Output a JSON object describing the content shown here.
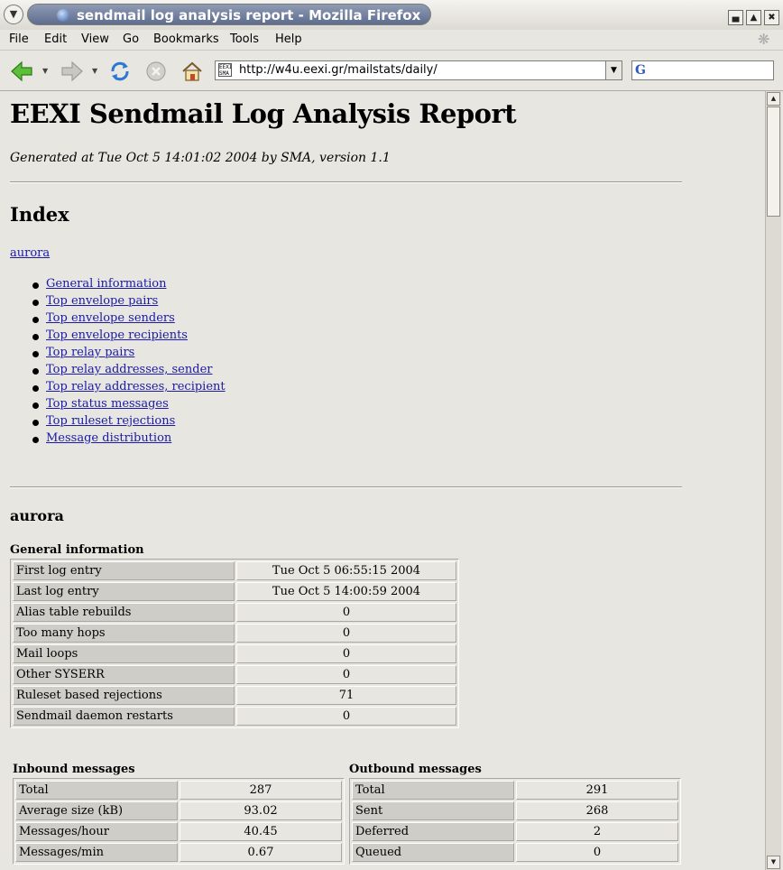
{
  "window": {
    "title": "sendmail log analysis report - Mozilla Firefox"
  },
  "menu": [
    "File",
    "Edit",
    "View",
    "Go",
    "Bookmarks",
    "Tools",
    "Help"
  ],
  "toolbar": {
    "url": "http://w4u.eexi.gr/mailstats/daily/",
    "favicon_text": "EEXI SMA",
    "search_engine_glyph": "G"
  },
  "page": {
    "title": "EEXI Sendmail Log Analysis Report",
    "generated": "Generated at Tue Oct 5 14:01:02 2004 by SMA, version 1.1",
    "index_heading": "Index",
    "host_link": "aurora",
    "index_links": [
      "General information",
      "Top envelope pairs",
      "Top envelope senders",
      "Top envelope recipients",
      "Top relay pairs",
      "Top relay addresses, sender",
      "Top relay addresses, recipient",
      "Top status messages",
      "Top ruleset rejections",
      "Message distribution"
    ],
    "host_title": "aurora",
    "general": {
      "caption": "General information",
      "rows": [
        {
          "label": "First log entry",
          "value": "Tue Oct 5 06:55:15 2004"
        },
        {
          "label": "Last log entry",
          "value": "Tue Oct 5 14:00:59 2004"
        },
        {
          "label": "Alias table rebuilds",
          "value": "0"
        },
        {
          "label": "Too many hops",
          "value": "0"
        },
        {
          "label": "Mail loops",
          "value": "0"
        },
        {
          "label": "Other SYSERR",
          "value": "0"
        },
        {
          "label": "Ruleset based rejections",
          "value": "71"
        },
        {
          "label": "Sendmail daemon restarts",
          "value": "0"
        }
      ]
    },
    "inbound": {
      "caption": "Inbound messages",
      "rows": [
        {
          "label": "Total",
          "value": "287"
        },
        {
          "label": "Average size (kB)",
          "value": "93.02"
        },
        {
          "label": "Messages/hour",
          "value": "40.45"
        },
        {
          "label": "Messages/min",
          "value": "0.67"
        }
      ]
    },
    "outbound": {
      "caption": "Outbound messages",
      "rows": [
        {
          "label": "Total",
          "value": "291"
        },
        {
          "label": "Sent",
          "value": "268"
        },
        {
          "label": "Deferred",
          "value": "2"
        },
        {
          "label": "Queued",
          "value": "0"
        }
      ]
    }
  },
  "colors": {
    "link": "#1a1aa6",
    "title_bar": "#5e6c8e",
    "chrome": "#e8e6e0"
  }
}
